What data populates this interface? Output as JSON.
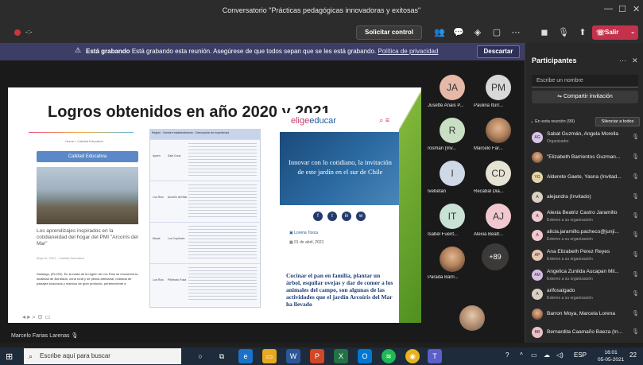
{
  "window": {
    "title": "Conversatorio \"Prácticas pedagógicas innovadoras y exitosas\"",
    "minimize": "—",
    "maximize": "☐",
    "close": "✕"
  },
  "toolbar": {
    "timer": "-:-",
    "control_button": "Solicitar control",
    "leave_button": "Salir"
  },
  "banner": {
    "bold": "Está grabando",
    "text": "Está grabando esta reunión. Asegúrese de que todos sepan que se les está grabando.",
    "link": "Política de privacidad",
    "dismiss": "Descartar"
  },
  "slide": {
    "title": "Logros obtenidos en año 2020 y 2021",
    "left_tiny": "Home » Calidad Educativa",
    "left_button": "Calidad Educativa",
    "left_caption": "Los aprendizajes inspirados en la cotidianeidad del hogar del PMI \"Arcoíris del Mar\"",
    "left_meta": "Mayo 6, 2021 · Calidad Educativa",
    "left_body": "Santiago, (ELIGE). En la costa de la región de Los Ríos se encuentra la localidad de Bonifacio, zona rural y de pesca artesanal, rodeada de paisajes boscosos y marinos de gran profundo, perteneciente a",
    "table_head": "Región · Nombre establecimiento · Descripción de experiencia",
    "table_rows": [
      {
        "region": "Aysén",
        "name": "Sala Cuna"
      },
      {
        "region": "Los Ríos",
        "name": "Arcoíris del Mar"
      },
      {
        "region": "Maule",
        "name": "Los Copihues"
      },
      {
        "region": "Los Ríos",
        "name": "Pitiñecito Ruka"
      }
    ],
    "logo_a": "elige",
    "logo_b": "educar",
    "hero_text": "Innovar con lo cotidiano, la invitación de este jardín en el sur de Chile",
    "author": "Lorena Tosca",
    "date": "01 de abril, 2021",
    "article_body": "Cocinar el pan en familia, plantar un árbol, esquilar ovejas y dar de comer a los animales del campo, son algunas de las actividades que el jardín Arcoíris del Mar ha llevado"
  },
  "presenter": "Marcelo Farias Larenas",
  "tiles": [
    {
      "initials": "JA",
      "name": "Jusette Anais P...",
      "color": "#e6b8a8"
    },
    {
      "initials": "PM",
      "name": "Paulina Iturr...",
      "color": "#d8d8d8"
    },
    {
      "initials": "R",
      "name": "rosmari (Inv...",
      "color": "#c9dfc3"
    },
    {
      "initials": "",
      "name": "Marcelo Far...",
      "color": "#c79a76"
    },
    {
      "initials": "I",
      "name": "Ivebetan",
      "color": "#cfd8e6"
    },
    {
      "initials": "CD",
      "name": "Recabal Dia...",
      "color": "#e6e2d4"
    },
    {
      "initials": "IT",
      "name": "Isabel Fuent...",
      "color": "#c9e2d6"
    },
    {
      "initials": "AJ",
      "name": "Alexia Beatr...",
      "color": "#f2c8cf"
    },
    {
      "initials": "",
      "name": "Parada Barri...",
      "color": "#c79a76"
    }
  ],
  "overflow_count": "+89",
  "panel": {
    "title": "Participantes",
    "name_placeholder": "Escribe un nombre",
    "share_button": "Compartir invitación",
    "section": "En esta reunión (99)",
    "mute_all": "Silenciar a todos",
    "people": [
      {
        "initials": "AG",
        "name": "Sabat Guzmán, Angela Morella",
        "sub": "Organizador",
        "color": "#d8c4e6"
      },
      {
        "initials": "",
        "name": "\"Elizabeth Barrientos Guzman...",
        "sub": "",
        "color": "#c4a284"
      },
      {
        "initials": "YG",
        "name": "Alderete Gaete, Yasna (Invitad...",
        "sub": "",
        "color": "#e2d6a8"
      },
      {
        "initials": "A",
        "name": "alejandra (Invitado)",
        "sub": "",
        "color": "#d9d0c2"
      },
      {
        "initials": "A",
        "name": "Alexia Beatriz Castro Jaramillo",
        "sub": "Externo a su organización",
        "color": "#f2c8cf"
      },
      {
        "initials": "A",
        "name": "alicia.jaramillo.pacheco@junji...",
        "sub": "Externo a su organización",
        "color": "#f2c8cf"
      },
      {
        "initials": "AP",
        "name": "Ana Elizabeth Perez Reyes",
        "sub": "Externo a su organización",
        "color": "#e6c3b3"
      },
      {
        "initials": "AM",
        "name": "Angelica Zunilda Aucapan Mil...",
        "sub": "Externo a su organización",
        "color": "#d6c0e3"
      },
      {
        "initials": "A",
        "name": "arifosalgado",
        "sub": "Externo a su organización",
        "color": "#d9d0c2"
      },
      {
        "initials": "",
        "name": "Barron Moya, Marcela Lorena",
        "sub": "",
        "color": "#b98a6b"
      },
      {
        "initials": "BB",
        "name": "Bernardita Caamaño Baeza (In...",
        "sub": "",
        "color": "#ecc0ca"
      }
    ]
  },
  "taskbar": {
    "search": "Escribe aquí para buscar",
    "lang": "ESP",
    "time": "16:01",
    "date": "05-05-2021",
    "notif": "22"
  }
}
